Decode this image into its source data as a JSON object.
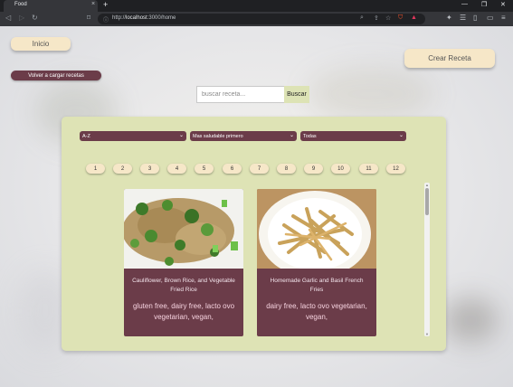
{
  "browser": {
    "tab_title": "Food",
    "tab_close": "×",
    "new_tab": "+",
    "url_prefix": "http://",
    "url_host": "localhost",
    "url_path": ":3000/home"
  },
  "page": {
    "home_button": "Inicio",
    "create_button": "Crear Receta",
    "reload_button": "Volver a cargar recetas",
    "search": {
      "placeholder": "buscar receta...",
      "button": "Buscar"
    },
    "filters": [
      {
        "selected": "A-Z"
      },
      {
        "selected": "Mas saludable primero"
      },
      {
        "selected": "Todas"
      }
    ],
    "pagination": [
      "1",
      "2",
      "3",
      "4",
      "5",
      "6",
      "7",
      "8",
      "9",
      "10",
      "11",
      "12"
    ],
    "recipes": [
      {
        "title": "Cauliflower, Brown Rice, and Vegetable Fried Rice",
        "diets": "gluten free, dairy free, lacto ovo vegetarian, vegan,"
      },
      {
        "title": "Homemade Garlic and Basil French Fries",
        "diets": "dairy free, lacto ovo vegetarian, vegan,"
      }
    ]
  },
  "colors": {
    "accent_dark": "#6b3c49",
    "panel": "#dee3b5",
    "button_beige": "#f6e7c8"
  }
}
